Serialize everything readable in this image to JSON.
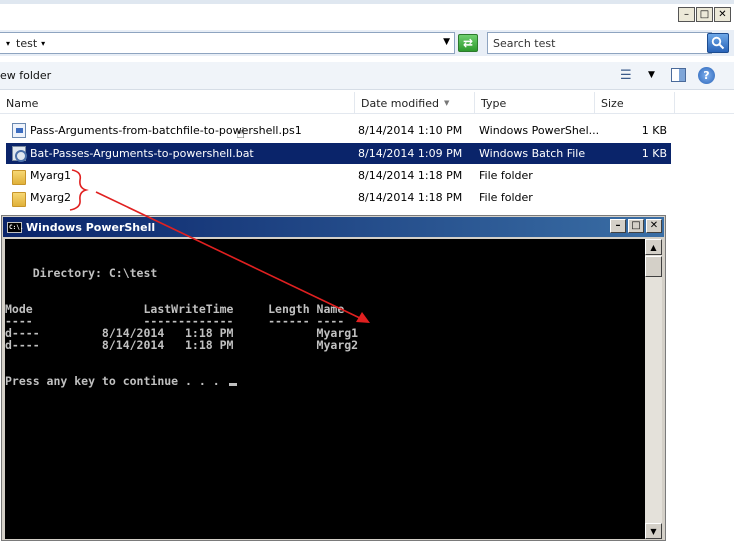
{
  "explorer": {
    "address": {
      "crumb_label": "test"
    },
    "search": {
      "placeholder": "Search test"
    },
    "toolbar": {
      "new_folder_label": "ew folder"
    },
    "columns": {
      "name": "Name",
      "date_modified": "Date modified",
      "type": "Type",
      "size": "Size"
    },
    "files": [
      {
        "name": "Pass-Arguments-from-batchfile-to-powershell.ps1",
        "date": "8/14/2014 1:10 PM",
        "type": "Windows PowerShel...",
        "size": "1 KB",
        "icon": "ps1-file-icon"
      },
      {
        "name": "Bat-Passes-Arguments-to-powershell.bat",
        "date": "8/14/2014 1:09 PM",
        "type": "Windows Batch File",
        "size": "1 KB",
        "icon": "bat-file-icon",
        "selected": true
      },
      {
        "name": "Myarg1",
        "date": "8/14/2014 1:18 PM",
        "type": "File folder",
        "size": "",
        "icon": "folder-icon"
      },
      {
        "name": "Myarg2",
        "date": "8/14/2014 1:18 PM",
        "type": "File folder",
        "size": "",
        "icon": "folder-icon"
      }
    ]
  },
  "powershell": {
    "title": "Windows PowerShell",
    "icon_label": "C:\\.",
    "console_lines": [
      "",
      "",
      "    Directory: C:\\test",
      "",
      "",
      "Mode                LastWriteTime     Length Name",
      "----                -------------     ------ ----",
      "d----         8/14/2014   1:18 PM            Myarg1",
      "d----         8/14/2014   1:18 PM            Myarg2",
      "",
      "",
      "Press any key to continue . . . "
    ]
  },
  "colors": {
    "selection": "#0a246a",
    "annotation": "#e02020",
    "console_bg": "#000000",
    "console_fg": "#c0c0c0"
  }
}
